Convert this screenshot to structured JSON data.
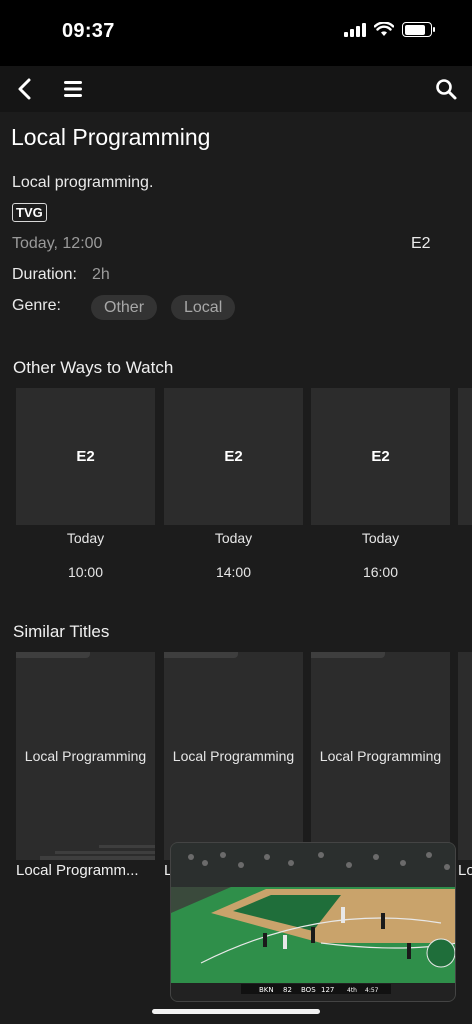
{
  "status": {
    "time": "09:37"
  },
  "nav": {
    "back_icon": "chevron-left-icon",
    "menu_icon": "hamburger-menu-icon",
    "search_icon": "search-icon"
  },
  "program": {
    "title": "Local Programming",
    "description": "Local programming.",
    "rating": "TVG",
    "airtime": "Today, 12:00",
    "channel": "E2",
    "duration_label": "Duration:",
    "duration_value": "2h",
    "genre_label": "Genre:",
    "genres": [
      "Other",
      "Local"
    ]
  },
  "other_ways": {
    "heading": "Other Ways to Watch",
    "items": [
      {
        "channel": "E2",
        "day": "Today",
        "time": "10:00"
      },
      {
        "channel": "E2",
        "day": "Today",
        "time": "14:00"
      },
      {
        "channel": "E2",
        "day": "Today",
        "time": "16:00"
      }
    ]
  },
  "similar": {
    "heading": "Similar Titles",
    "items": [
      {
        "card_label": "Local Programming",
        "caption": "Local Programm..."
      },
      {
        "card_label": "Local Programming",
        "caption": "L"
      },
      {
        "card_label": "Local Programming",
        "caption": ""
      }
    ],
    "peek_caption": "Lo"
  },
  "pip": {
    "scorebug": {
      "team_a": "BKN",
      "score_a": "82",
      "team_b": "BOS",
      "score_b": "127",
      "quarter": "4th",
      "clock": "4:57"
    },
    "colors": {
      "court": "#2f8f4a",
      "paint": "#1f6e3a",
      "wood": "#c9a36b"
    }
  }
}
